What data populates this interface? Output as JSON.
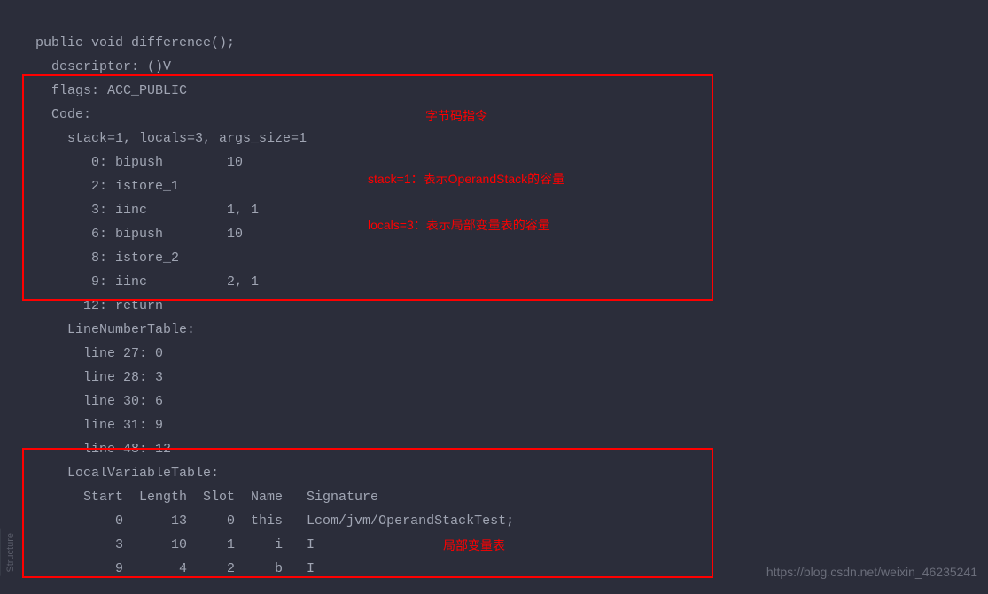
{
  "code": {
    "line1": "public void difference();",
    "line2": "  descriptor: ()V",
    "line3": "  flags: ACC_PUBLIC",
    "line4": "  Code:",
    "line5": "    stack=1, locals=3, args_size=1",
    "line6": "       0: bipush        10",
    "line7": "       2: istore_1",
    "line8": "       3: iinc          1, 1",
    "line9": "       6: bipush        10",
    "line10": "       8: istore_2",
    "line11": "       9: iinc          2, 1",
    "line12": "      12: return",
    "line13": "    LineNumberTable:",
    "line14": "      line 27: 0",
    "line15": "      line 28: 3",
    "line16": "      line 30: 6",
    "line17": "      line 31: 9",
    "line18": "      line 48: 12",
    "line19": "    LocalVariableTable:",
    "line20": "      Start  Length  Slot  Name   Signature",
    "line21": "          0      13     0  this   Lcom/jvm/OperandStackTest;",
    "line22": "          3      10     1     i   I",
    "line23": "          9       4     2     b   I"
  },
  "annotations": {
    "bytecode_instruction": "字节码指令",
    "stack_note": "stack=1：表示OperandStack的容量",
    "locals_note": "locals=3：表示局部变量表的容量",
    "local_var_table": "局部变量表"
  },
  "watermark": "https://blog.csdn.net/weixin_46235241",
  "sidebar": "Structure"
}
